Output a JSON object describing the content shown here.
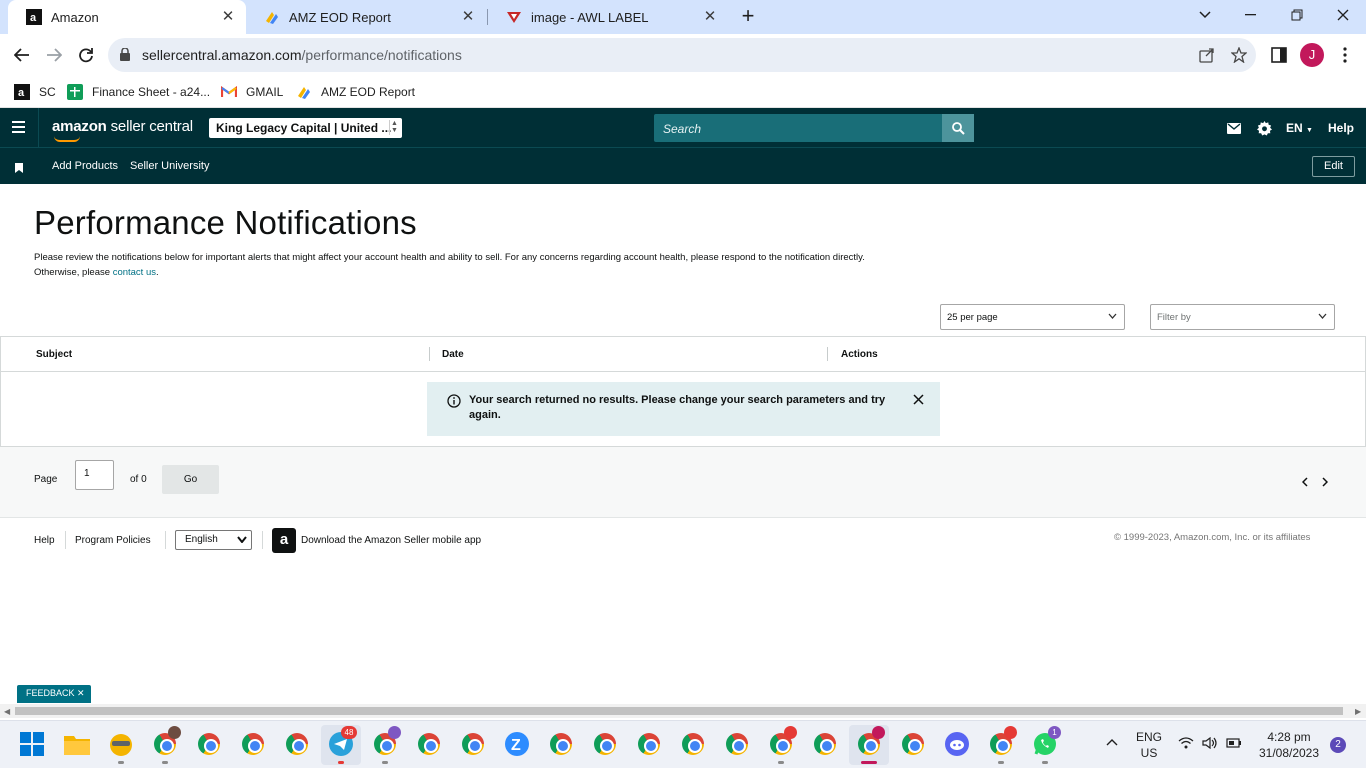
{
  "browser": {
    "tabs": [
      {
        "title": "Amazon",
        "active": true
      },
      {
        "title": "AMZ EOD Report",
        "active": false
      },
      {
        "title": "image - AWL LABEL",
        "active": false
      }
    ],
    "url_host": "sellercentral.amazon.com",
    "url_path": "/performance/notifications",
    "profile_initial": "J",
    "bookmarks": [
      {
        "label": "SC",
        "icon": "amazon-icon"
      },
      {
        "label": "Finance Sheet - a24...",
        "icon": "google-sheets-icon"
      },
      {
        "label": "GMAIL",
        "icon": "gmail-icon"
      },
      {
        "label": "AMZ EOD Report",
        "icon": "report-icon"
      }
    ]
  },
  "header": {
    "logo_brand": "amazon",
    "logo_product": "seller central",
    "account": "King Legacy Capital | United ...",
    "search_placeholder": "Search",
    "language": "EN",
    "help": "Help"
  },
  "subnav": {
    "items": [
      "Add Products",
      "Seller University"
    ],
    "edit": "Edit"
  },
  "main": {
    "title": "Performance Notifications",
    "intro": "Please review the notifications below for important alerts that might affect your account health and ability to sell. For any concerns regarding account health, please respond to the notification directly. Otherwise, please ",
    "intro_link": "contact us",
    "intro_end": ".",
    "per_page": "25 per page",
    "filter_placeholder": "Filter by",
    "columns": [
      "Subject",
      "Date",
      "Actions"
    ],
    "alert": "Your search returned no results. Please change your search parameters and try again.",
    "pager": {
      "label": "Page",
      "value": "1",
      "of": "of 0",
      "go": "Go"
    }
  },
  "footer": {
    "help": "Help",
    "program_policies": "Program Policies",
    "language": "English",
    "app_download": "Download the Amazon Seller mobile app",
    "copyright": "© 1999-2023, Amazon.com, Inc. or its affiliates"
  },
  "feedback": "FEEDBACK",
  "taskbar": {
    "badges": {
      "telegram": "48",
      "whatsapp": "1",
      "notifications": "2"
    },
    "lang_top": "ENG",
    "lang_bottom": "US",
    "time": "4:28 pm",
    "date": "31/08/2023"
  },
  "colors": {
    "header_bg": "#002f36",
    "search_bg": "#196e78",
    "link": "#007185",
    "alert_bg": "#e2eff1",
    "tabbar_bg": "#d3e3fd"
  }
}
